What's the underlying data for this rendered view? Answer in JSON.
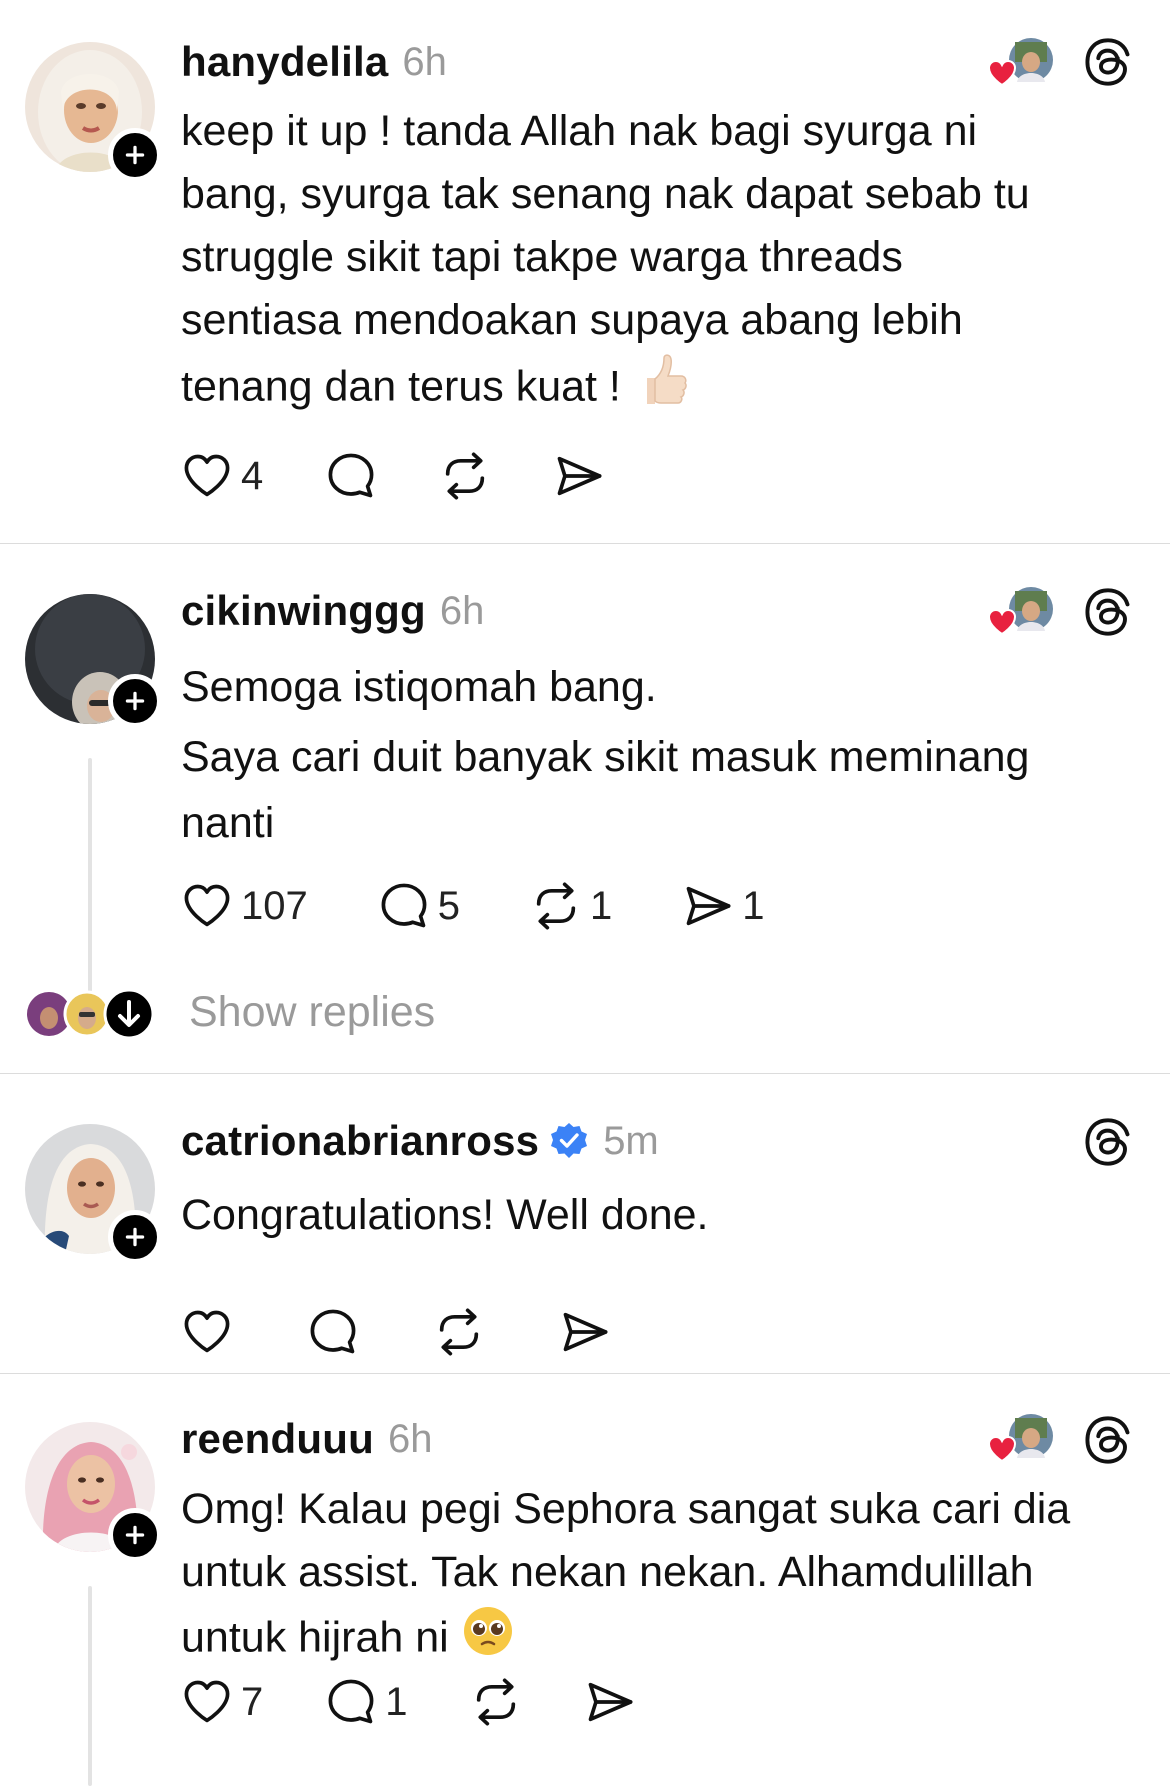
{
  "colors": {
    "text": "#111111",
    "muted": "#9a9a9a",
    "divider": "#dcdcdc",
    "thread_line": "#e3e3e3",
    "like_heart": "#e8213f",
    "verified_blue": "#3b82f6"
  },
  "icons": {
    "like": "heart-outline-icon",
    "reply": "speech-bubble-icon",
    "repost": "repost-arrows-icon",
    "share": "send-arrow-icon",
    "follow": "plus-icon",
    "app": "threads-logo-icon",
    "show_replies": "arrow-down-icon"
  },
  "posts": [
    {
      "username": "hanydelila",
      "time": "6h",
      "verified": false,
      "liked_by_author": true,
      "lines": [
        "keep it up ! tanda Allah nak bagi syurga ni",
        "bang, syurga tak senang nak dapat  sebab tu",
        "struggle sikit  tapi takpe warga threads",
        "sentiasa mendoakan supaya abang lebih",
        "tenang dan terus kuat ! "
      ],
      "emoji": "thumbs-up-light-skin-tone",
      "likes": "4",
      "replies": "",
      "reposts": "",
      "shares": ""
    },
    {
      "username": "cikinwinggg",
      "time": "6h",
      "verified": false,
      "liked_by_author": true,
      "lines": [
        "Semoga istiqomah bang.",
        "Saya cari duit banyak sikit masuk meminang",
        "nanti"
      ],
      "likes": "107",
      "replies": "5",
      "reposts": "1",
      "shares": "1",
      "show_replies_label": "Show replies"
    },
    {
      "username": "catrionabrianross",
      "time": "5m",
      "verified": true,
      "liked_by_author": false,
      "lines": [
        "Congratulations! Well done."
      ],
      "likes": "",
      "replies": "",
      "reposts": "",
      "shares": ""
    },
    {
      "username": "reenduuu",
      "time": "6h",
      "verified": false,
      "liked_by_author": true,
      "lines": [
        "Omg! Kalau pegi Sephora sangat suka cari dia",
        "untuk assist. Tak nekan nekan. Alhamdulillah",
        "untuk hijrah ni "
      ],
      "emoji": "pleading-face",
      "likes": "7",
      "replies": "1",
      "reposts": "",
      "shares": ""
    }
  ]
}
